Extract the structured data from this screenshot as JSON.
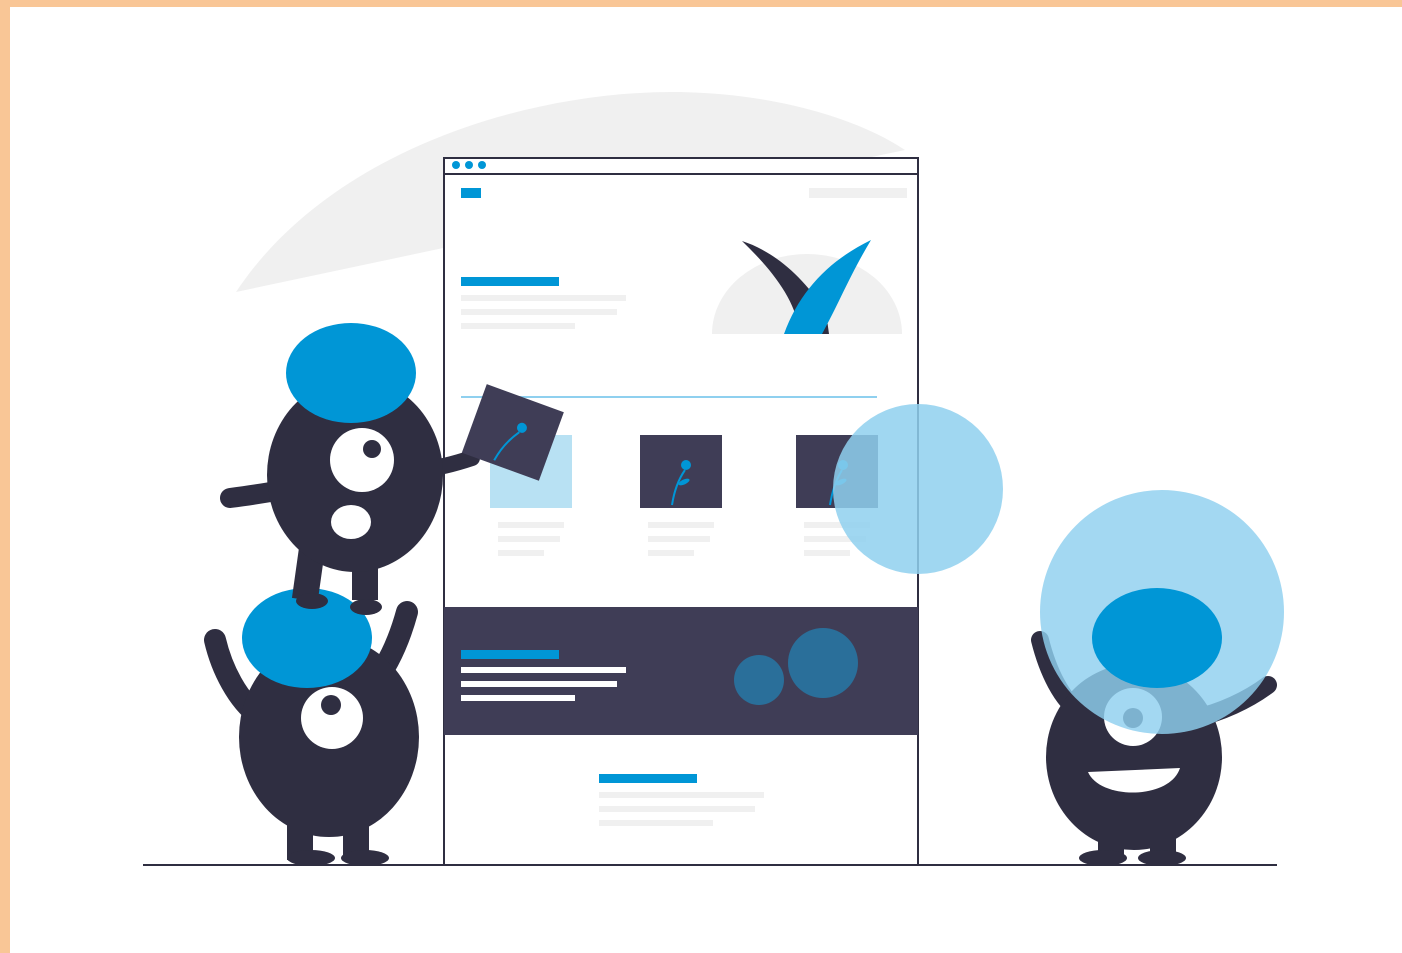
{
  "colors": {
    "frame": "#f9c696",
    "ink": "#2f2e41",
    "accent": "#0096d6",
    "accent_light": "#8fd0ef",
    "placeholder": "#f0f0f0",
    "background": "#ffffff"
  },
  "illustration": {
    "mockup_window": {
      "dots": [
        "dot",
        "dot",
        "dot"
      ],
      "cards": [
        "card",
        "card",
        "card"
      ]
    },
    "monsters": [
      "monster-top-left",
      "monster-bottom-left",
      "monster-right"
    ],
    "icons": [
      "checkmark-icon",
      "image-icon",
      "flower-icon"
    ]
  }
}
